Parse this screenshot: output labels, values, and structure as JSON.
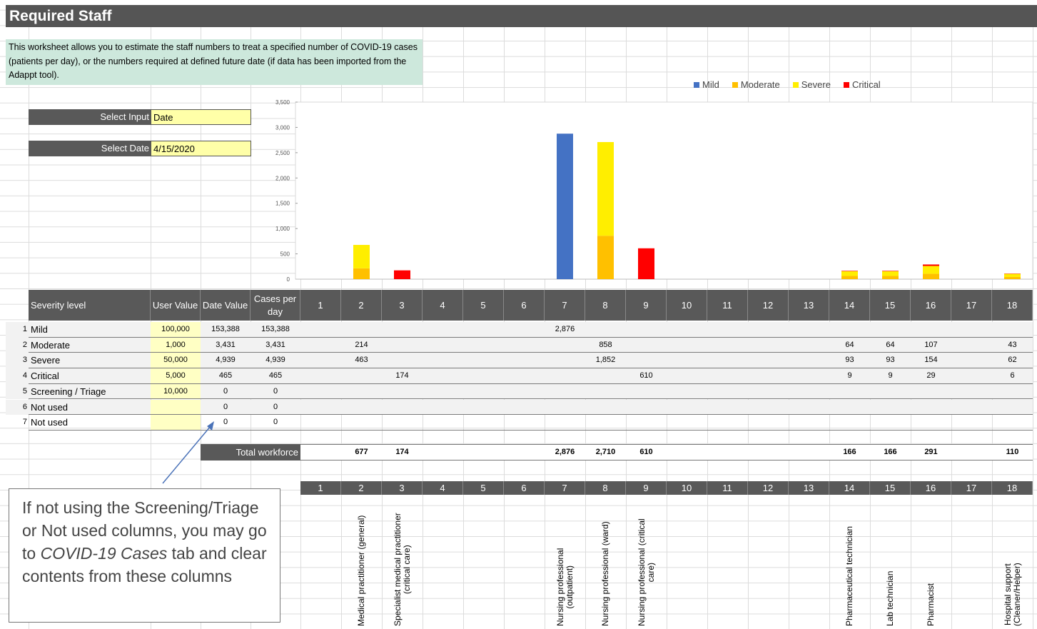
{
  "title": "Required Staff",
  "intro": "This worksheet allows you to estimate the staff numbers to treat a specified number of COVID-19 cases (patients per day), or the numbers required at defined future date (if data has been imported from the Adappt tool).",
  "select_input": {
    "label": "Select Input",
    "value": "Date"
  },
  "select_date": {
    "label": "Select Date",
    "value": "4/15/2020"
  },
  "table": {
    "headers": {
      "severity": "Severity level",
      "user": "User Value",
      "date": "Date Value",
      "cases": "Cases per day"
    },
    "columns": [
      "1",
      "2",
      "3",
      "4",
      "5",
      "6",
      "7",
      "8",
      "9",
      "10",
      "11",
      "12",
      "13",
      "14",
      "15",
      "16",
      "17",
      "18"
    ],
    "rows": [
      {
        "idx": "1",
        "label": "Mild",
        "user": "100,000",
        "date": "153,388",
        "cases": "153,388",
        "vals": [
          "",
          "",
          "",
          "",
          "",
          "",
          "2,876",
          "",
          "",
          "",
          "",
          "",
          "",
          "",
          "",
          "",
          "",
          ""
        ]
      },
      {
        "idx": "2",
        "label": "Moderate",
        "user": "1,000",
        "date": "3,431",
        "cases": "3,431",
        "vals": [
          "",
          "214",
          "",
          "",
          "",
          "",
          "",
          "858",
          "",
          "",
          "",
          "",
          "",
          "64",
          "64",
          "107",
          "",
          "43"
        ]
      },
      {
        "idx": "3",
        "label": "Severe",
        "user": "50,000",
        "date": "4,939",
        "cases": "4,939",
        "vals": [
          "",
          "463",
          "",
          "",
          "",
          "",
          "",
          "1,852",
          "",
          "",
          "",
          "",
          "",
          "93",
          "93",
          "154",
          "",
          "62"
        ]
      },
      {
        "idx": "4",
        "label": "Critical",
        "user": "5,000",
        "date": "465",
        "cases": "465",
        "vals": [
          "",
          "",
          "174",
          "",
          "",
          "",
          "",
          "",
          "610",
          "",
          "",
          "",
          "",
          "9",
          "9",
          "29",
          "",
          "6"
        ]
      },
      {
        "idx": "5",
        "label": "Screening / Triage",
        "user": "10,000",
        "date": "0",
        "cases": "0",
        "vals": [
          "",
          "",
          "",
          "",
          "",
          "",
          "",
          "",
          "",
          "",
          "",
          "",
          "",
          "",
          "",
          "",
          "",
          ""
        ]
      },
      {
        "idx": "6",
        "label": "Not used",
        "user": "",
        "date": "0",
        "cases": "0",
        "vals": [
          "",
          "",
          "",
          "",
          "",
          "",
          "",
          "",
          "",
          "",
          "",
          "",
          "",
          "",
          "",
          "",
          "",
          ""
        ]
      },
      {
        "idx": "7",
        "label": "Not used",
        "user": "",
        "date": "0",
        "cases": "0",
        "vals": [
          "",
          "",
          "",
          "",
          "",
          "",
          "",
          "",
          "",
          "",
          "",
          "",
          "",
          "",
          "",
          "",
          "",
          ""
        ]
      }
    ],
    "total_label": "Total workforce",
    "totals": [
      "",
      "677",
      "174",
      "",
      "",
      "",
      "2,876",
      "2,710",
      "610",
      "",
      "",
      "",
      "",
      "166",
      "166",
      "291",
      "",
      "110"
    ]
  },
  "staff_labels": [
    "",
    "Medical practitioner (general)",
    "Specialist medical practitioner\n(critical care)",
    "",
    "",
    "",
    "Nursing professional\n(outpatient)",
    "Nursing professional (ward)",
    "Nursing professional (critical\ncare)",
    "",
    "",
    "",
    "",
    "Pharmaceutical technician",
    "Lab technician",
    "Pharmacist",
    "",
    "Hospital support\n(Cleaner/Helper)"
  ],
  "callout": {
    "line1": "If not using the Screening/Triage or Not used columns, you may go to ",
    "italic": "COVID-19 Cases",
    "line2": " tab and clear contents from these columns"
  },
  "chart_data": {
    "type": "bar",
    "stacked": true,
    "categories": [
      "1",
      "2",
      "3",
      "4",
      "5",
      "6",
      "7",
      "8",
      "9",
      "10",
      "11",
      "12",
      "13",
      "14",
      "15",
      "16",
      "17",
      "18"
    ],
    "ylim": [
      0,
      3500
    ],
    "yticks": [
      "0",
      "500",
      "1,000",
      "1,500",
      "2,000",
      "2,500",
      "3,000",
      "3,500"
    ],
    "legend_position": "top-right",
    "series": [
      {
        "name": "Mild",
        "color": "#4472c4",
        "values": [
          0,
          0,
          0,
          0,
          0,
          0,
          2876,
          0,
          0,
          0,
          0,
          0,
          0,
          0,
          0,
          0,
          0,
          0
        ]
      },
      {
        "name": "Moderate",
        "color": "#ffc000",
        "values": [
          0,
          214,
          0,
          0,
          0,
          0,
          0,
          858,
          0,
          0,
          0,
          0,
          0,
          64,
          64,
          107,
          0,
          43
        ]
      },
      {
        "name": "Severe",
        "color": "#ffee00",
        "values": [
          0,
          463,
          0,
          0,
          0,
          0,
          0,
          1852,
          0,
          0,
          0,
          0,
          0,
          93,
          93,
          154,
          0,
          62
        ]
      },
      {
        "name": "Critical",
        "color": "#ff0000",
        "values": [
          0,
          0,
          174,
          0,
          0,
          0,
          0,
          0,
          610,
          0,
          0,
          0,
          0,
          9,
          9,
          29,
          0,
          6
        ]
      }
    ]
  }
}
